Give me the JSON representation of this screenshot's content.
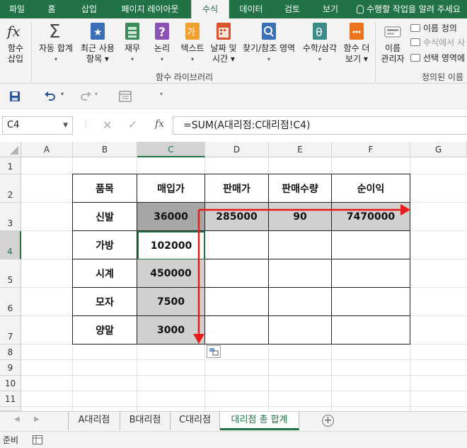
{
  "ribbon_tabs": [
    "파일",
    "홈",
    "삽입",
    "페이지 레이아웃",
    "수식",
    "데이터",
    "검토",
    "보기"
  ],
  "active_tab_index": 4,
  "tell_me": "수행할 작업을 알려 주세요",
  "ribbon": {
    "insert_function": {
      "icon": "fx-icon",
      "line1": "함수",
      "line2": "삽입"
    },
    "autosum": {
      "icon": "sigma-icon",
      "line1": "자동 합계",
      "line2": "▾"
    },
    "recent": {
      "icon": "star-book-icon",
      "line1": "최근 사용",
      "line2": "항목 ▾"
    },
    "financial": {
      "icon": "money-icon",
      "line1": "재무",
      "line2": "▾"
    },
    "logical": {
      "icon": "question-book-icon",
      "line1": "논리",
      "line2": "▾"
    },
    "text": {
      "icon": "text-book-icon",
      "glyph": "가",
      "line1": "텍스트",
      "line2": "▾"
    },
    "datetime": {
      "icon": "calendar-icon",
      "line1": "날짜 및",
      "line2": "시간 ▾"
    },
    "lookup": {
      "icon": "search-book-icon",
      "line1": "찾기/참조 영역",
      "line2": "▾"
    },
    "math": {
      "icon": "theta-icon",
      "glyph": "θ",
      "line1": "수학/삼각",
      "line2": "▾"
    },
    "more": {
      "icon": "more-functions-icon",
      "line1": "함수 더",
      "line2": "보기 ▾"
    },
    "library_label": "함수 라이브러리",
    "name_manager": {
      "icon": "name-manager-icon",
      "line1": "이름",
      "line2": "관리자"
    },
    "define_name": "이름 정의",
    "use_in_formula": "수식에서 사",
    "create_from_selection": "선택 영역에",
    "defined_names_label": "정의된 이름"
  },
  "namebox": "C4",
  "formula": "=SUM(A대리점:C대리점!C4)",
  "fx_label": "fx",
  "columns": [
    "A",
    "B",
    "C",
    "D",
    "E",
    "F",
    "G"
  ],
  "rows": [
    "1",
    "2",
    "3",
    "4",
    "5",
    "6",
    "7",
    "8",
    "9",
    "10",
    "11"
  ],
  "table": {
    "headers": [
      "품목",
      "매입가",
      "판매가",
      "판매수량",
      "순이익"
    ],
    "items": [
      "신발",
      "가방",
      "시계",
      "모자",
      "양말"
    ],
    "purchase": [
      "36000",
      "102000",
      "450000",
      "7500",
      "3000"
    ],
    "row3": {
      "sale": "285000",
      "qty": "90",
      "profit": "7470000"
    }
  },
  "sheets": [
    "A대리점",
    "B대리점",
    "C대리점",
    "대리점 총 합계"
  ],
  "active_sheet_index": 3,
  "status": "준비",
  "colors": {
    "excel_green": "#217346",
    "arrow_red": "#e81b1b"
  }
}
